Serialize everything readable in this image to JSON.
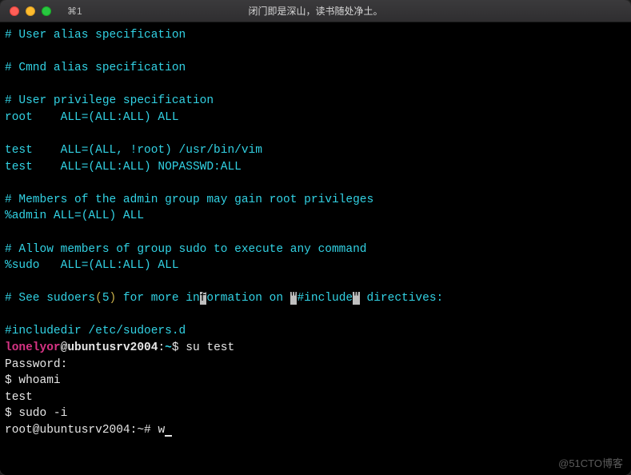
{
  "titlebar": {
    "tab_label": "⌘1",
    "title": "闭门即是深山，读书随处净土。"
  },
  "content": {
    "l1": "# User alias specification",
    "l2": "",
    "l3": "# Cmnd alias specification",
    "l4": "",
    "l5": "# User privilege specification",
    "l6": "root    ALL=(ALL:ALL) ALL",
    "l7": "",
    "l8": "test    ALL=(ALL, !root) /usr/bin/vim",
    "l9": "test    ALL=(ALL:ALL) NOPASSWD:ALL",
    "l10": "",
    "l11": "# Members of the admin group may gain root privileges",
    "l12": "%admin ALL=(ALL) ALL",
    "l13": "",
    "l14": "# Allow members of group sudo to execute any command",
    "l15": "%sudo   ALL=(ALL:ALL) ALL",
    "l16": "",
    "see_a": "# See sudoers",
    "see_b": "(",
    "see_c": "5",
    "see_d": ")",
    "see_e": " for more in",
    "see_f": "f",
    "see_g": "ormation on ",
    "see_h": "\"",
    "see_i": "#include",
    "see_j": "\"",
    "see_k": " directives:",
    "l18": "",
    "l19": "#includedir /etc/sudoers.d",
    "prompt_user": "lonelyor",
    "prompt_at_host": "@ubuntusrv2004",
    "prompt_colon": ":",
    "prompt_path": "~",
    "prompt_dollar": "$ ",
    "su_cmd": "su test",
    "pw_label": "Password:",
    "whoami_prompt": "$ ",
    "whoami_cmd": "whoami",
    "whoami_out": "test",
    "sudo_prompt": "$ ",
    "sudo_cmd": "sudo -i",
    "root_prompt": "root@ubuntusrv2004:~# ",
    "root_cmd": "w"
  },
  "watermark": "@51CTO博客"
}
